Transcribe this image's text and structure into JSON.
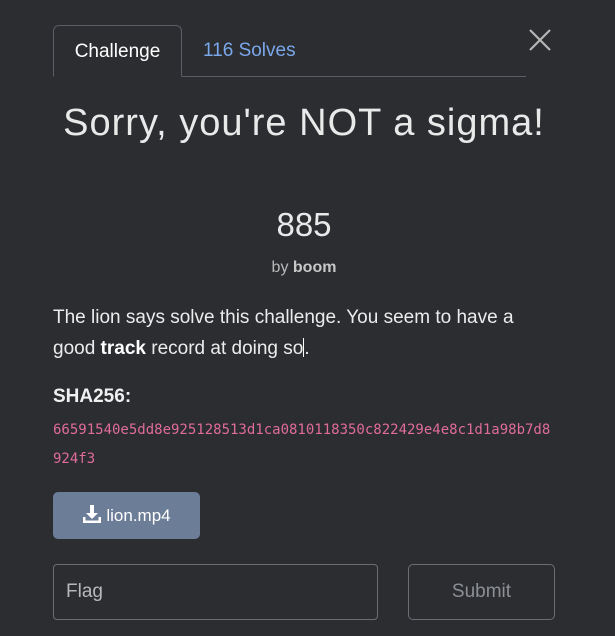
{
  "tabs": {
    "challenge": "Challenge",
    "solves": "116 Solves"
  },
  "challenge": {
    "title": "Sorry, you're NOT a sigma!",
    "points": "885",
    "author_prefix": "by",
    "author": "boom",
    "description": {
      "part1": "The lion says solve this challenge. You seem to have a good ",
      "bold": "track",
      "part2": " record at doing so",
      "part3": "."
    },
    "sha_label": "SHA256:",
    "sha_value": "66591540e5dd8e925128513d1ca0810118350c822429e4e8c1d1a98b7d8924f3"
  },
  "download": {
    "label": "lion.mp4",
    "icon": "download-icon"
  },
  "form": {
    "flag_placeholder": "Flag",
    "flag_value": "",
    "submit_label": "Submit"
  },
  "icons": {
    "close": "close-icon"
  },
  "colors": {
    "background": "#2b2d31",
    "accent_link": "#7aa7ea",
    "hash": "#e06c99",
    "download_button": "#6c7d97"
  }
}
